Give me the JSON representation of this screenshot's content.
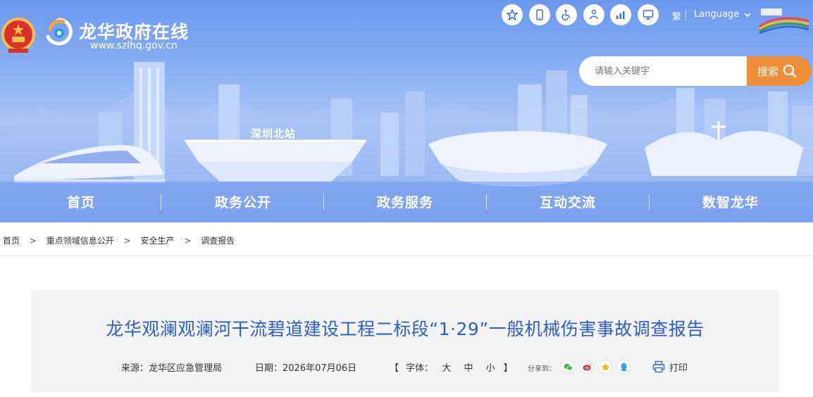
{
  "header": {
    "site_title": "龙华政府在线",
    "site_url": "www.szlhq.gov.cn",
    "traditional_label": "繁",
    "language_label": "Language",
    "tool_icons": [
      "star-icon",
      "mobile-icon",
      "wheelchair-icon",
      "person-icon",
      "chart-icon",
      "monitor-icon"
    ],
    "brand_color": "#ef8f3a"
  },
  "search": {
    "placeholder": "请输入关键字",
    "button_label": "搜索"
  },
  "banner": {
    "station_label": "深圳北站"
  },
  "nav": {
    "items": [
      {
        "label": "首页"
      },
      {
        "label": "政务公开"
      },
      {
        "label": "政务服务"
      },
      {
        "label": "互动交流"
      },
      {
        "label": "数智龙华"
      }
    ]
  },
  "breadcrumb": {
    "items": [
      "首页",
      "重点领域信息公开",
      "安全生产",
      "调查报告"
    ],
    "separator": ">"
  },
  "article": {
    "title": "龙华观澜观澜河干流碧道建设工程二标段“1·29”一般机械伤害事故调查报告",
    "title_color": "#2d5ec3",
    "source": "来源：龙华区应急管理局",
    "date": "日期：2026年07月06日",
    "font_size_label": "字体：",
    "font_sizes": [
      "大",
      "中",
      "小"
    ],
    "bracket_open": "【",
    "bracket_close": "】",
    "share_label": "分享到：",
    "share_icons": [
      "wechat-icon",
      "weibo-icon",
      "favorite-icon",
      "qq-icon"
    ],
    "print_label": "打印"
  }
}
